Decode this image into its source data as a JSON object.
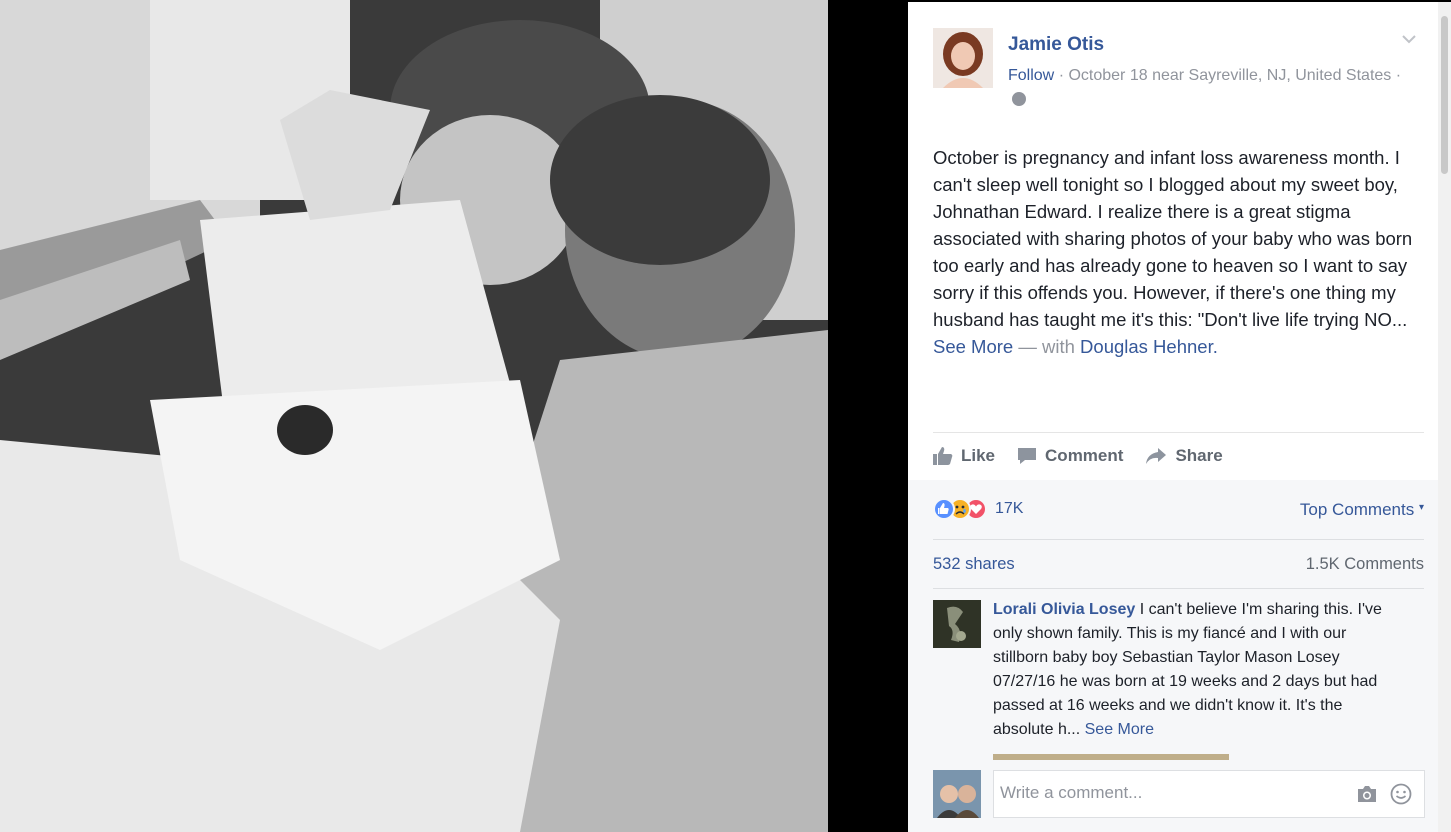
{
  "post": {
    "author": "Jamie Otis",
    "follow_label": "Follow",
    "meta_text": "· October 18 near Sayreville, NJ, United States ·",
    "text": "October is pregnancy and infant loss awareness month. I can't sleep well tonight so I blogged about my sweet boy, Johnathan Edward. I realize there is a great stigma associated with sharing photos of your baby who was born too early and has already gone to heaven so I want to say sorry if this offends you. However, if there's one thing my husband has taught me it's this: \"Don't live life trying NO...",
    "see_more": "See More",
    "with_prefix": "— with",
    "tagged": "Douglas Hehner."
  },
  "actions": {
    "like": "Like",
    "comment": "Comment",
    "share": "Share"
  },
  "reactions": {
    "count": "17K",
    "icons": [
      "like-icon",
      "sad-icon",
      "love-icon"
    ],
    "top_comments": "Top Comments",
    "shares": "532 shares",
    "comments": "1.5K Comments"
  },
  "comment": {
    "author": "Lorali Olivia Losey",
    "text": "I can't believe I'm sharing this. I've only shown family. This is my fiancé and I with our stillborn baby boy Sebastian Taylor Mason Losey 07/27/16 he was born at 19 weeks and 2 days but had passed at 16 weeks and we didn't know it. It's the absolute h...",
    "see_more": "See More"
  },
  "composer": {
    "placeholder": "Write a comment..."
  },
  "colors": {
    "link": "#365899",
    "meta": "#90949c",
    "text": "#1d2129",
    "panel_bg": "#ffffff",
    "footer_bg": "#f6f7f9"
  }
}
